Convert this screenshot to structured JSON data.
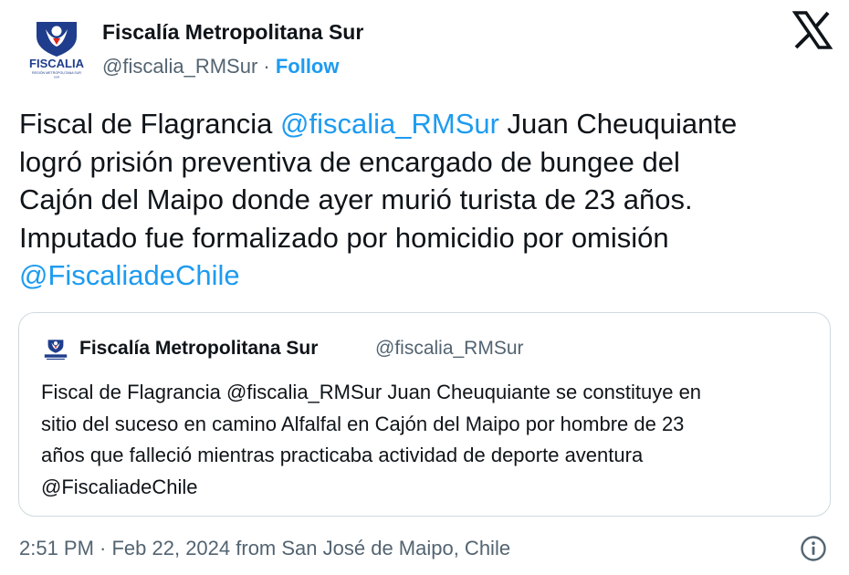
{
  "author": {
    "name": "Fiscalía Metropolitana Sur",
    "handle": "@fiscalia_RMSur",
    "separator": " · ",
    "follow_label": "Follow",
    "logo_text": "FISCALIA",
    "logo_subtext": "REGIÓN METROPOLITANA SUR"
  },
  "platform_icon": "x-logo-icon",
  "tweet": {
    "lines": [
      {
        "text": "Fiscal de Flagrancia ",
        "mention": "@fiscalia_RMSur",
        "after": " Juan Cheuquiante"
      },
      {
        "text": "logró prisión preventiva de encargado de bungee del"
      },
      {
        "text": "Cajón del Maipo donde ayer murió turista de 23 años."
      },
      {
        "text": "Imputado fue formalizado por homicidio por omisión"
      },
      {
        "mention": "@FiscaliadeChile"
      }
    ]
  },
  "quoted_tweet": {
    "name": "Fiscalía Metropolitana Sur",
    "handle": "@fiscalia_RMSur",
    "lines": [
      "Fiscal de Flagrancia @fiscalia_RMSur Juan Cheuquiante se constituye en",
      "sitio del suceso en camino Alfalfal en Cajón del Maipo por hombre de 23",
      "años que falleció mientras practicaba actividad de deporte aventura",
      "@FiscaliadeChile"
    ]
  },
  "footer": {
    "timestamp": "2:51 PM · Feb 22, 2024 from San José de Maipo, Chile",
    "info_icon": "info-icon"
  },
  "colors": {
    "brand_blue": "#1d9bf0",
    "text": "#0f1419",
    "muted": "#536471",
    "border": "#cfd9de",
    "logo_blue": "#1f3d8c",
    "logo_red": "#e1251b"
  }
}
